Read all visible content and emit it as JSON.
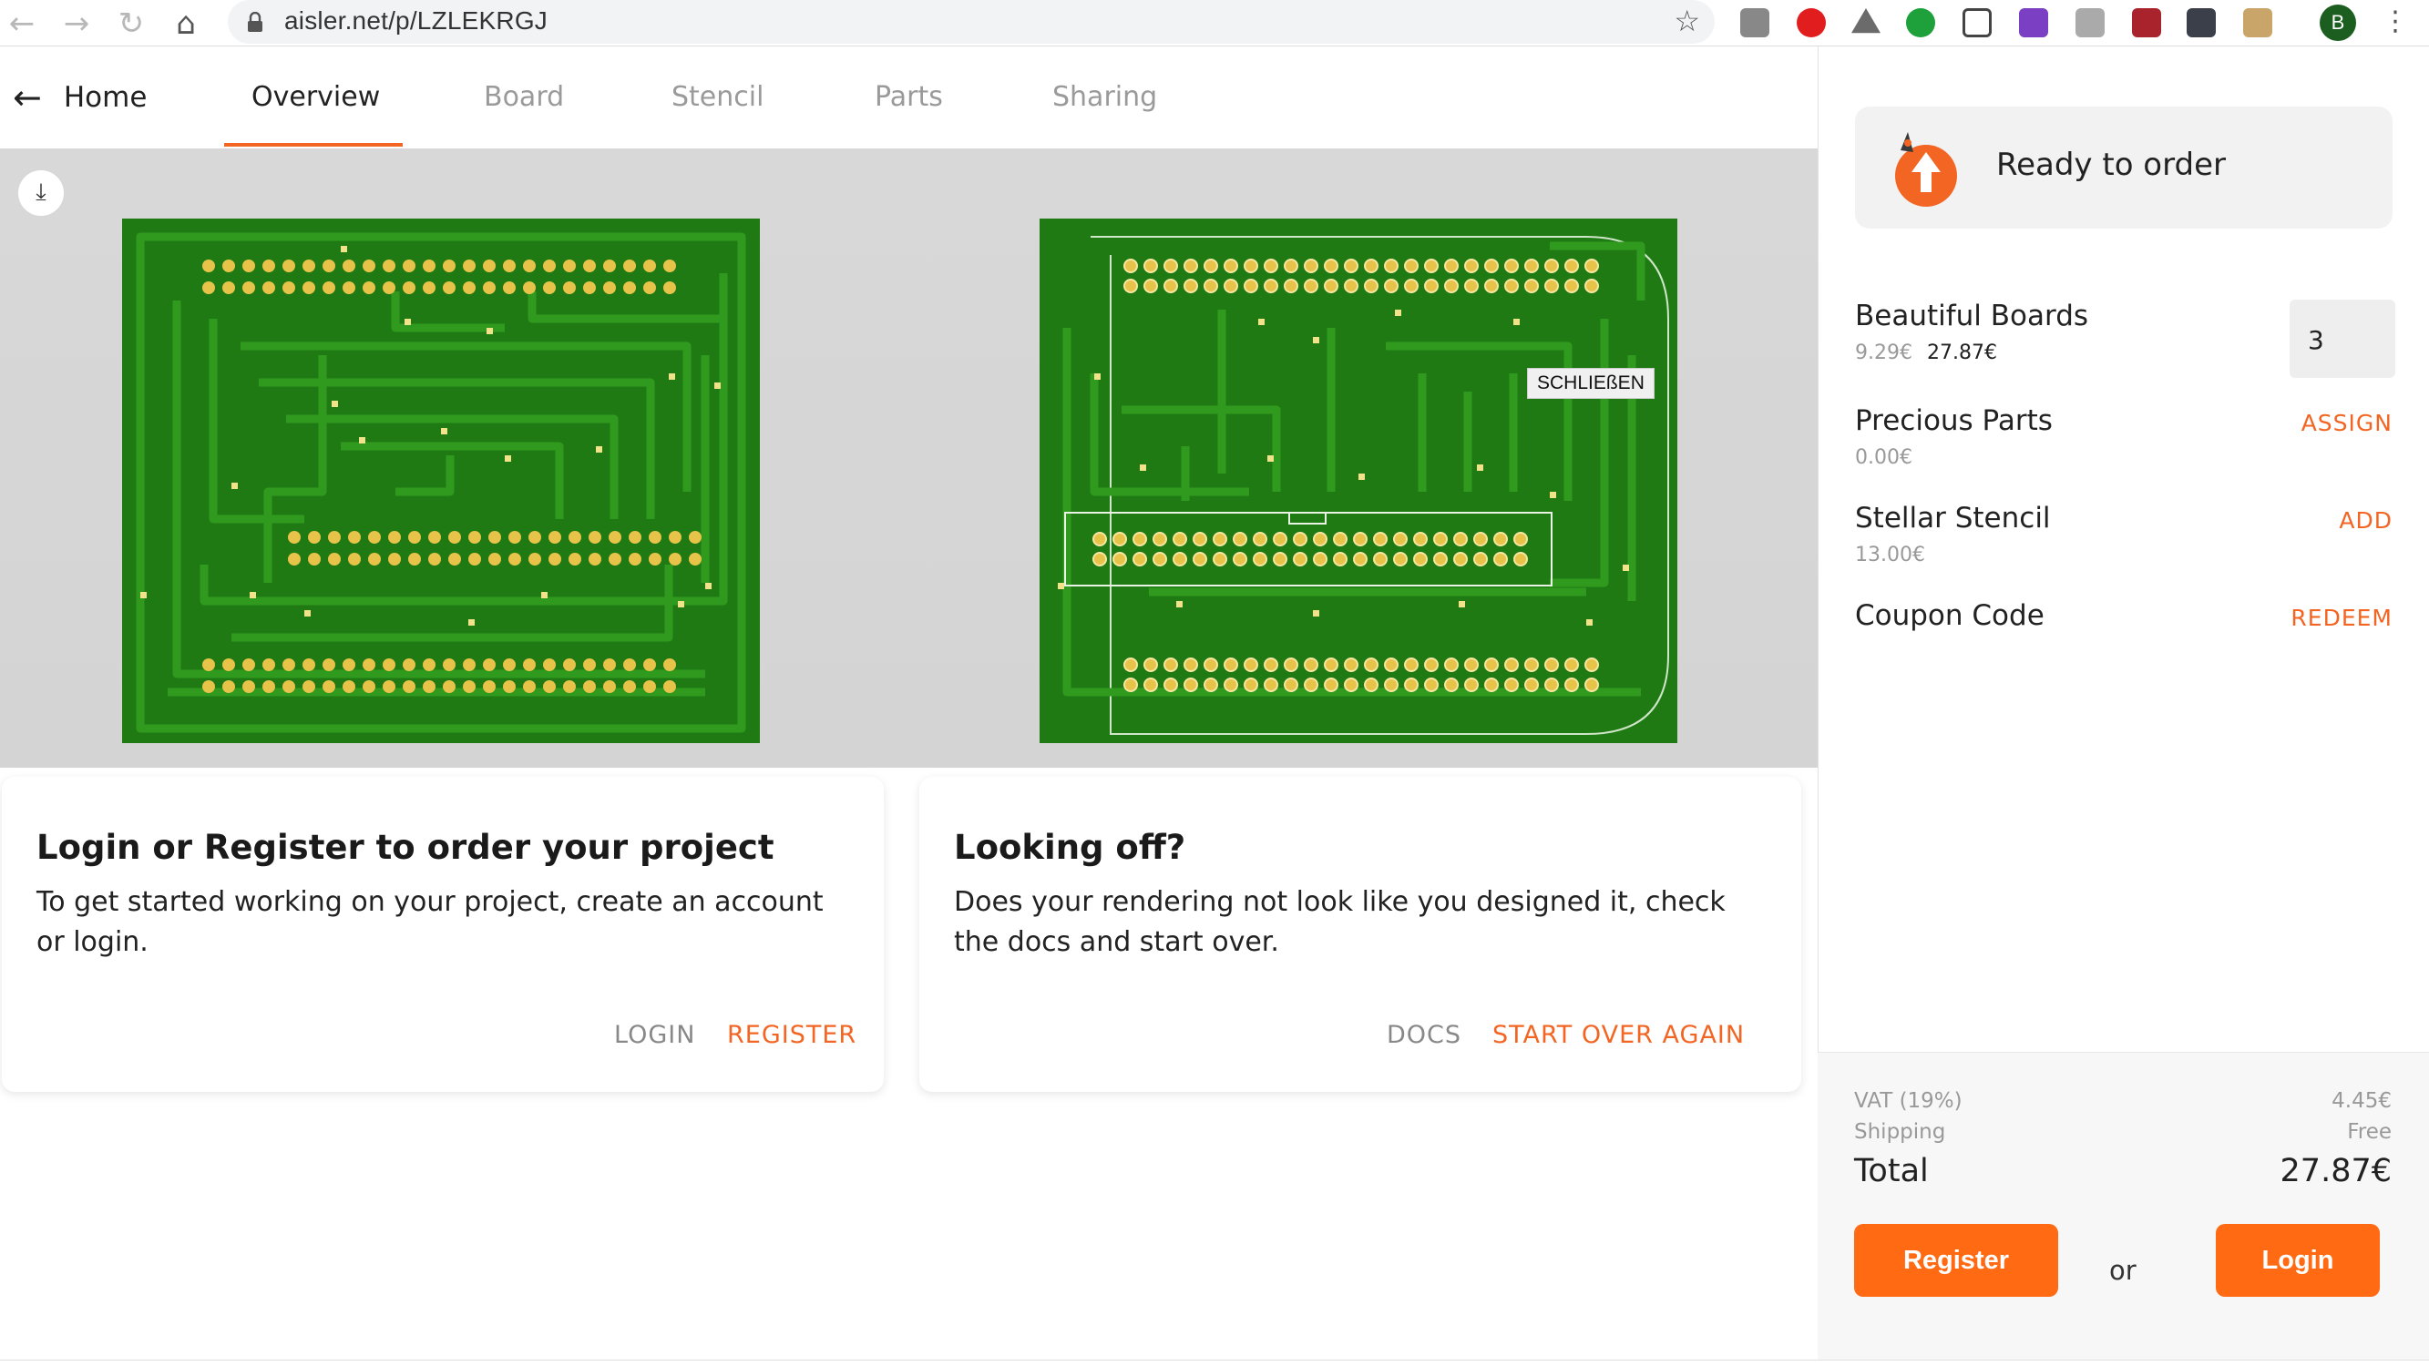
{
  "browser": {
    "url": "aisler.net/p/LZLEKRGJ",
    "avatar_letter": "B"
  },
  "nav": {
    "home_label": "Home",
    "tabs": [
      {
        "label": "Overview",
        "active": true
      },
      {
        "label": "Board",
        "active": false
      },
      {
        "label": "Stencil",
        "active": false
      },
      {
        "label": "Parts",
        "active": false
      },
      {
        "label": "Sharing",
        "active": false
      }
    ]
  },
  "preview": {
    "close_label": "SCHLIEßEN"
  },
  "cards": [
    {
      "title": "Login or Register to order your project",
      "text": "To get started working on your project, create an account or login.",
      "actions": [
        "LOGIN",
        "REGISTER"
      ]
    },
    {
      "title": "Looking off?",
      "text": "Does your rendering not look like you designed it, check the docs and start over.",
      "actions": [
        "DOCS",
        "START OVER AGAIN"
      ]
    }
  ],
  "sidebar": {
    "status": "Ready to order",
    "items": [
      {
        "title": "Beautiful Boards",
        "unit_price": "9.29€",
        "total": "27.87€",
        "quantity": "3"
      },
      {
        "title": "Precious Parts",
        "price": "0.00€",
        "action": "ASSIGN"
      },
      {
        "title": "Stellar Stencil",
        "price": "13.00€",
        "action": "ADD"
      },
      {
        "title": "Coupon Code",
        "action": "REDEEM"
      }
    ],
    "summary": {
      "vat_label": "VAT (19%)",
      "vat_value": "4.45€",
      "shipping_label": "Shipping",
      "shipping_value": "Free",
      "total_label": "Total",
      "total_value": "27.87€"
    },
    "register_label": "Register",
    "or_label": "or",
    "login_label": "Login"
  },
  "colors": {
    "accent": "#ff6a13",
    "pcb_green": "#1f7a14",
    "trace_green": "#2f9a1e",
    "pad_gold": "#e8c34a"
  }
}
